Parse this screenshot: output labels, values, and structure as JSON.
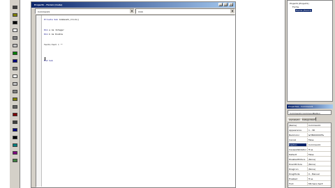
{
  "code_window": {
    "title": "Project1 - Form1 (Code)",
    "object_combo": "Command1",
    "proc_combo": "Click",
    "lines": [
      {
        "kw": "Private Sub ",
        "text": "Command1_Click()"
      },
      {
        "kw": "Dim ",
        "text": "a As Integer"
      },
      {
        "kw": "Dim ",
        "text": "b As Double"
      },
      {
        "kw": "",
        "text": "Text1.Text = \"\""
      },
      {
        "kw": "End Sub",
        "text": ""
      }
    ]
  },
  "window_buttons": {
    "minimize": "_",
    "maximize": "□",
    "close": "×"
  },
  "toolbox": {
    "tools": [
      "pointer-icon",
      "picture-box-icon",
      "label-icon",
      "textbox-icon",
      "frame-icon",
      "command-button-icon",
      "checkbox-icon",
      "option-button-icon",
      "combo-box-icon",
      "list-box-icon",
      "hscroll-icon",
      "vscroll-icon",
      "timer-icon",
      "drive-list-icon",
      "dir-list-icon",
      "file-list-icon",
      "shape-icon",
      "line-icon",
      "image-icon",
      "data-icon",
      "ole-icon"
    ]
  },
  "project_explorer": {
    "items": [
      {
        "label": "Project1 (Project1)",
        "selected": false
      },
      {
        "label": "Forms",
        "selected": false
      },
      {
        "label": "Form1 (Form1)",
        "selected": true
      }
    ]
  },
  "properties": {
    "title": "Properties - Command1",
    "object": "Command1 CommandButton",
    "tabs": [
      "Alphabetic",
      "Categorized"
    ],
    "rows": [
      {
        "name": "(Name)",
        "value": "Command1"
      },
      {
        "name": "Appearance",
        "value": "1 - 3D"
      },
      {
        "name": "BackColor",
        "value": "&H8000000F&"
      },
      {
        "name": "Cancel",
        "value": "False"
      },
      {
        "name": "Caption",
        "value": "Command1"
      },
      {
        "name": "CausesValidation",
        "value": "True"
      },
      {
        "name": "Default",
        "value": "False"
      },
      {
        "name": "DisabledPicture",
        "value": "(None)"
      },
      {
        "name": "DownPicture",
        "value": "(None)"
      },
      {
        "name": "DragIcon",
        "value": "(None)"
      },
      {
        "name": "DragMode",
        "value": "0 - Manual"
      },
      {
        "name": "Enabled",
        "value": "True"
      },
      {
        "name": "Font",
        "value": "MS Sans Serif"
      }
    ],
    "selected_row": 4
  },
  "colors": {
    "title_active": "#0a246a",
    "chrome": "#d4d0c8",
    "keyword": "#000080"
  }
}
